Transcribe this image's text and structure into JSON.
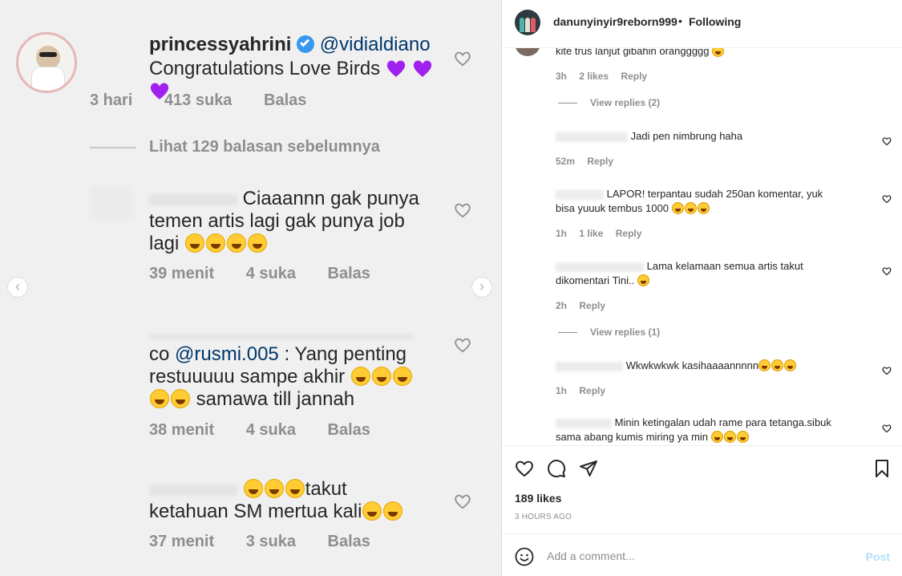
{
  "image_panel": {
    "comments": [
      {
        "username": "princessyahrini",
        "mention": "@vidialdiano",
        "text": "Congratulations Love Birds",
        "time": "3 hari",
        "likes": "413 suka",
        "reply": "Balas"
      },
      {
        "text_line1": "Ciaaannn gak punya",
        "text_line2": "temen artis lagi gak punya job",
        "text_line3": "lagi",
        "time": "39 menit",
        "likes": "4 suka",
        "reply": "Balas"
      },
      {
        "prefix": "co",
        "mention": "@rusmi.005",
        "text_line1": ": Yang penting",
        "text_line2": "restuuuuu sampe akhir",
        "text_line3": "samawa till jannah",
        "time": "38 menit",
        "likes": "4 suka",
        "reply": "Balas"
      },
      {
        "text_line1": "takut",
        "text_line2": "ketahuan SM mertua kali",
        "time": "37 menit",
        "likes": "3 suka",
        "reply": "Balas"
      }
    ],
    "view_previous": "Lihat 129 balasan sebelumnya",
    "nav_prev": "‹",
    "nav_next": "›"
  },
  "post": {
    "username": "danunyinyir9reborn999",
    "separator": "•",
    "follow_status": "Following"
  },
  "comments": [
    {
      "text": "kite trus lanjut gibahin oranggggg",
      "time": "3h",
      "likes": "2 likes",
      "reply": "Reply"
    },
    {
      "view_replies": "View replies (2)"
    },
    {
      "text": "Jadi pen nimbrung haha",
      "time": "52m",
      "reply": "Reply"
    },
    {
      "text_a": "LAPOR! terpantau sudah 250an komentar, yuk",
      "text_b": "bisa yuuuk tembus 1000",
      "time": "1h",
      "likes": "1 like",
      "reply": "Reply"
    },
    {
      "text_a": "Lama kelamaan semua artis takut",
      "text_b": "dikomentari Tini..",
      "time": "2h",
      "reply": "Reply"
    },
    {
      "view_replies": "View replies (1)"
    },
    {
      "text": "Wkwkwkwk kasihaaaannnnn",
      "time": "1h",
      "reply": "Reply"
    },
    {
      "text_a": "Minin ketingalan udah rame para tetanga.sibuk",
      "text_b": "sama abang kumis miring ya min"
    }
  ],
  "actions": {
    "likes": "189 likes",
    "time_ago": "3 HOURS AGO"
  },
  "add_comment": {
    "placeholder": "Add a comment...",
    "post_label": "Post"
  },
  "colors": {
    "link_mention": "#00376b",
    "muted": "#8e8e8e",
    "verified": "#3897f0",
    "post_disabled": "#b2dffc"
  }
}
